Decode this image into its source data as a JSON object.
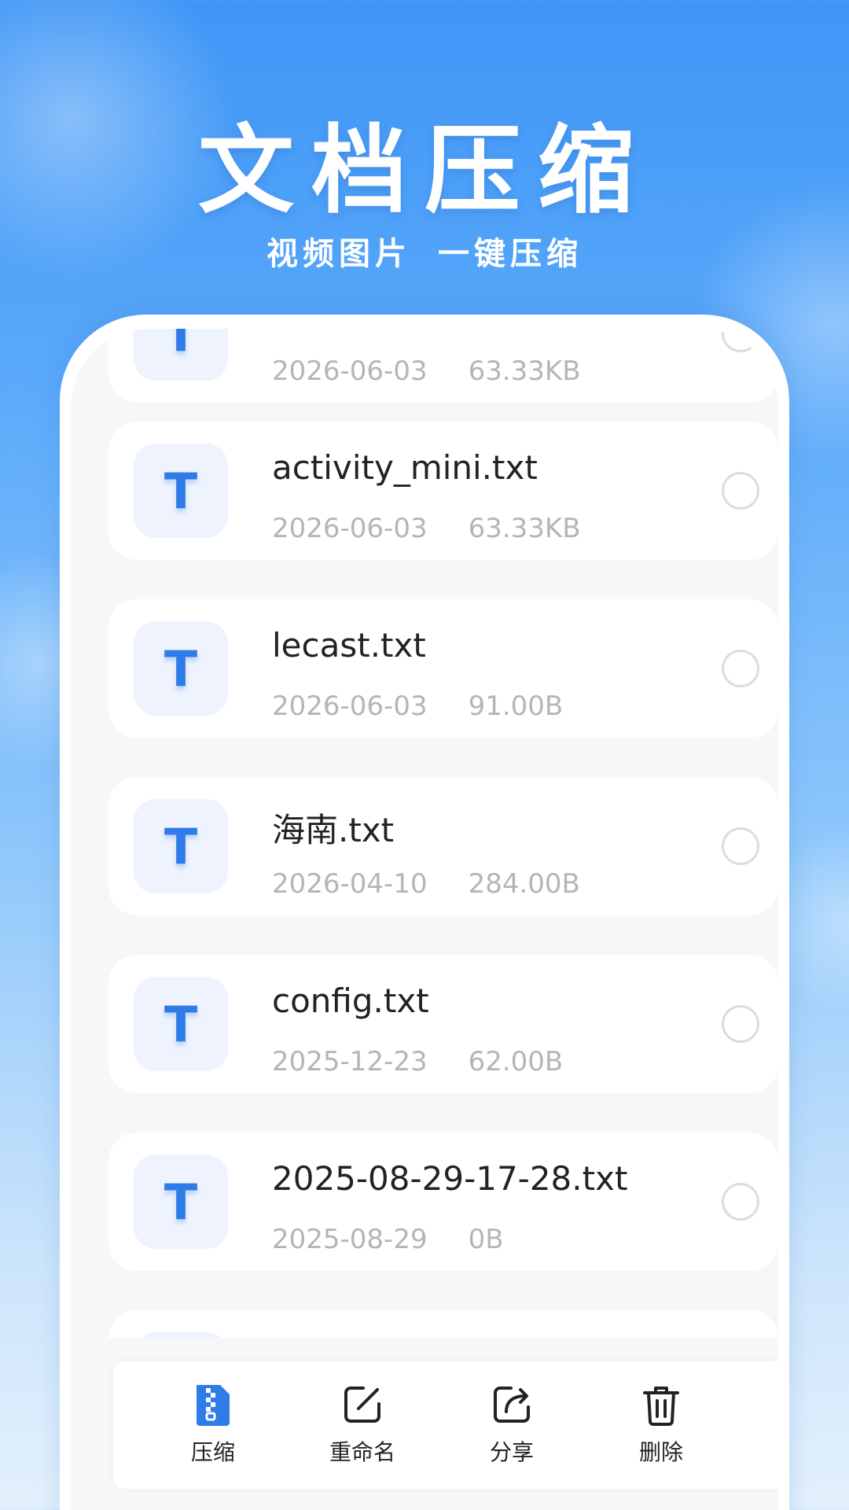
{
  "header": {
    "title": "文档压缩",
    "subtitle_left": "视频图片",
    "subtitle_right": "一键压缩"
  },
  "colors": {
    "accent": "#2f7be8",
    "icon_bg": "#eef3fe",
    "meta_text": "#b5b5b5"
  },
  "files": [
    {
      "icon": "T",
      "name": "",
      "date": "2026-06-03",
      "size": "63.33KB"
    },
    {
      "icon": "T",
      "name": "activity_mini.txt",
      "date": "2026-06-03",
      "size": "63.33KB"
    },
    {
      "icon": "T",
      "name": "lecast.txt",
      "date": "2026-06-03",
      "size": "91.00B"
    },
    {
      "icon": "T",
      "name": "海南.txt",
      "date": "2026-04-10",
      "size": "284.00B"
    },
    {
      "icon": "T",
      "name": "config.txt",
      "date": "2025-12-23",
      "size": "62.00B"
    },
    {
      "icon": "T",
      "name": "2025-08-29-17-28.txt",
      "date": "2025-08-29",
      "size": "0B"
    }
  ],
  "toolbar": {
    "compress_label": "压缩",
    "rename_label": "重命名",
    "share_label": "分享",
    "delete_label": "删除"
  }
}
